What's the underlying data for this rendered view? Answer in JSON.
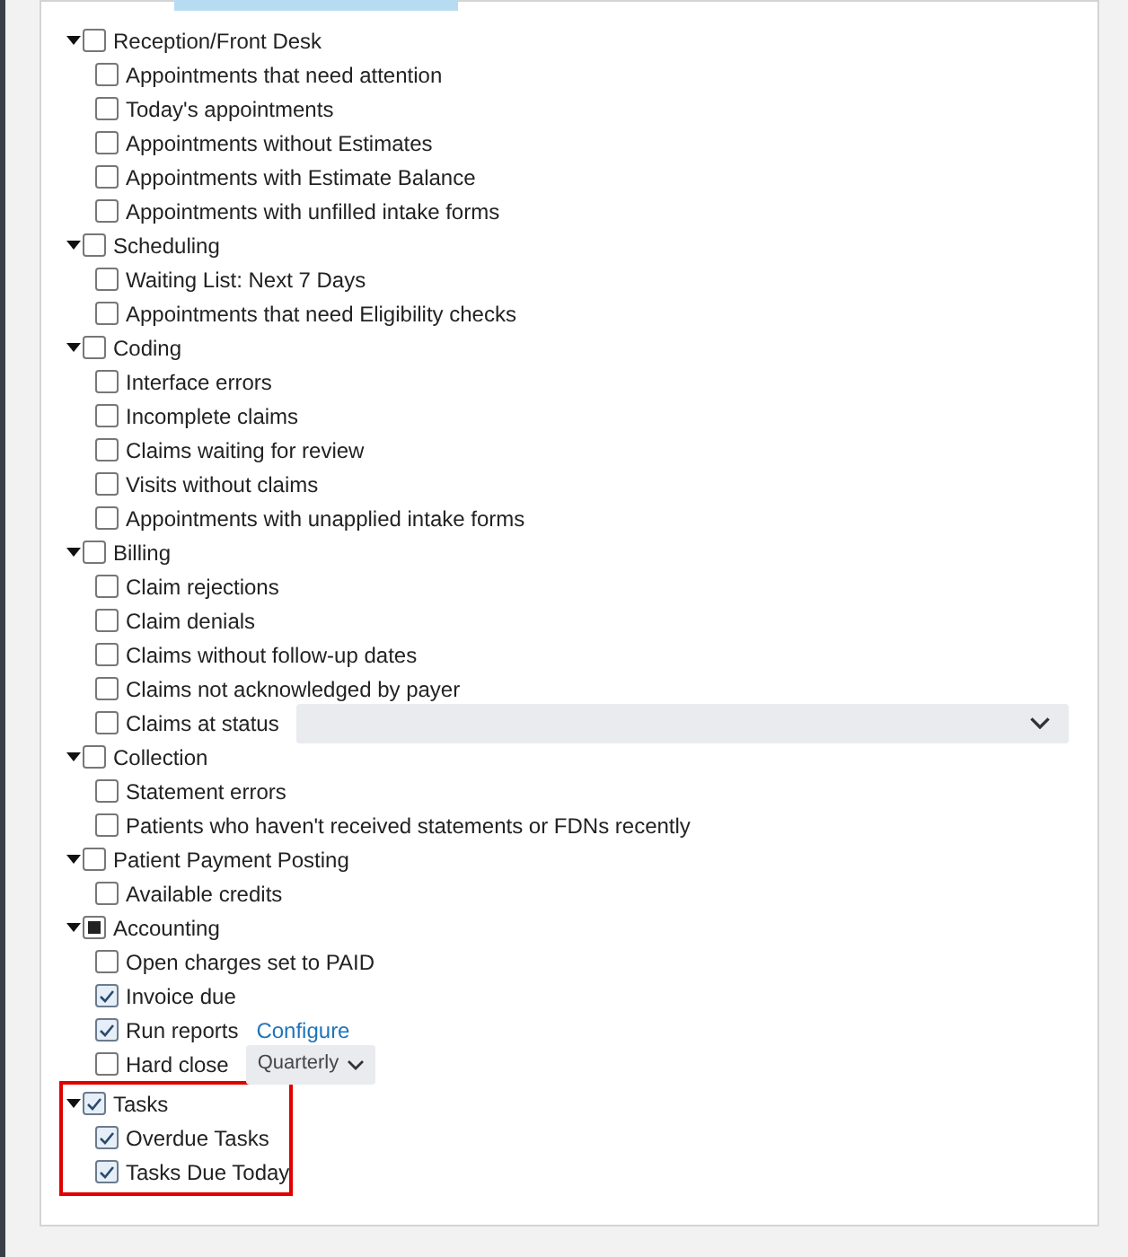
{
  "groups": [
    {
      "label": "Reception/Front Desk",
      "expanded": true,
      "checked": false,
      "indeterminate": false,
      "highlighted": false,
      "children": [
        {
          "kind": "plain",
          "label": "Appointments that need attention",
          "checked": false
        },
        {
          "kind": "plain",
          "label": "Today's appointments",
          "checked": false
        },
        {
          "kind": "plain",
          "label": "Appointments without Estimates",
          "checked": false
        },
        {
          "kind": "plain",
          "label": "Appointments with Estimate Balance",
          "checked": false
        },
        {
          "kind": "plain",
          "label": "Appointments with unfilled intake forms",
          "checked": false
        }
      ]
    },
    {
      "label": "Scheduling",
      "expanded": true,
      "checked": false,
      "indeterminate": false,
      "highlighted": false,
      "children": [
        {
          "kind": "plain",
          "label": "Waiting List: Next 7 Days",
          "checked": false
        },
        {
          "kind": "plain",
          "label": "Appointments that need Eligibility checks",
          "checked": false
        }
      ]
    },
    {
      "label": "Coding",
      "expanded": true,
      "checked": false,
      "indeterminate": false,
      "highlighted": false,
      "children": [
        {
          "kind": "plain",
          "label": "Interface errors",
          "checked": false
        },
        {
          "kind": "plain",
          "label": "Incomplete claims",
          "checked": false
        },
        {
          "kind": "plain",
          "label": "Claims waiting for review",
          "checked": false
        },
        {
          "kind": "plain",
          "label": "Visits without claims",
          "checked": false
        },
        {
          "kind": "plain",
          "label": "Appointments with unapplied intake forms",
          "checked": false
        }
      ]
    },
    {
      "label": "Billing",
      "expanded": true,
      "checked": false,
      "indeterminate": false,
      "highlighted": false,
      "children": [
        {
          "kind": "plain",
          "label": "Claim rejections",
          "checked": false
        },
        {
          "kind": "plain",
          "label": "Claim denials",
          "checked": false
        },
        {
          "kind": "plain",
          "label": "Claims without follow-up dates",
          "checked": false
        },
        {
          "kind": "plain",
          "label": "Claims not acknowledged by payer",
          "checked": false
        },
        {
          "kind": "select",
          "label": "Claims at status",
          "checked": false
        }
      ]
    },
    {
      "label": "Collection",
      "expanded": true,
      "checked": false,
      "indeterminate": false,
      "highlighted": false,
      "children": [
        {
          "kind": "plain",
          "label": "Statement errors",
          "checked": false
        },
        {
          "kind": "plain",
          "label": "Patients who haven't received statements or FDNs recently",
          "checked": false
        }
      ]
    },
    {
      "label": "Patient Payment Posting",
      "expanded": true,
      "checked": false,
      "indeterminate": false,
      "highlighted": false,
      "children": [
        {
          "kind": "plain",
          "label": "Available credits",
          "checked": false
        }
      ]
    },
    {
      "label": "Accounting",
      "expanded": true,
      "checked": false,
      "indeterminate": true,
      "highlighted": false,
      "children": [
        {
          "kind": "plain",
          "label": "Open charges set to PAID",
          "checked": false
        },
        {
          "kind": "plain",
          "label": "Invoice due",
          "checked": true
        },
        {
          "kind": "link",
          "label": "Run reports",
          "checked": true,
          "link": "Configure"
        },
        {
          "kind": "dropdown",
          "label": "Hard close",
          "checked": false,
          "value": "Quarterly"
        }
      ]
    },
    {
      "label": "Tasks",
      "expanded": true,
      "checked": true,
      "indeterminate": false,
      "highlighted": true,
      "children": [
        {
          "kind": "plain",
          "label": "Overdue Tasks",
          "checked": true
        },
        {
          "kind": "plain",
          "label": "Tasks Due Today",
          "checked": true
        }
      ]
    }
  ]
}
